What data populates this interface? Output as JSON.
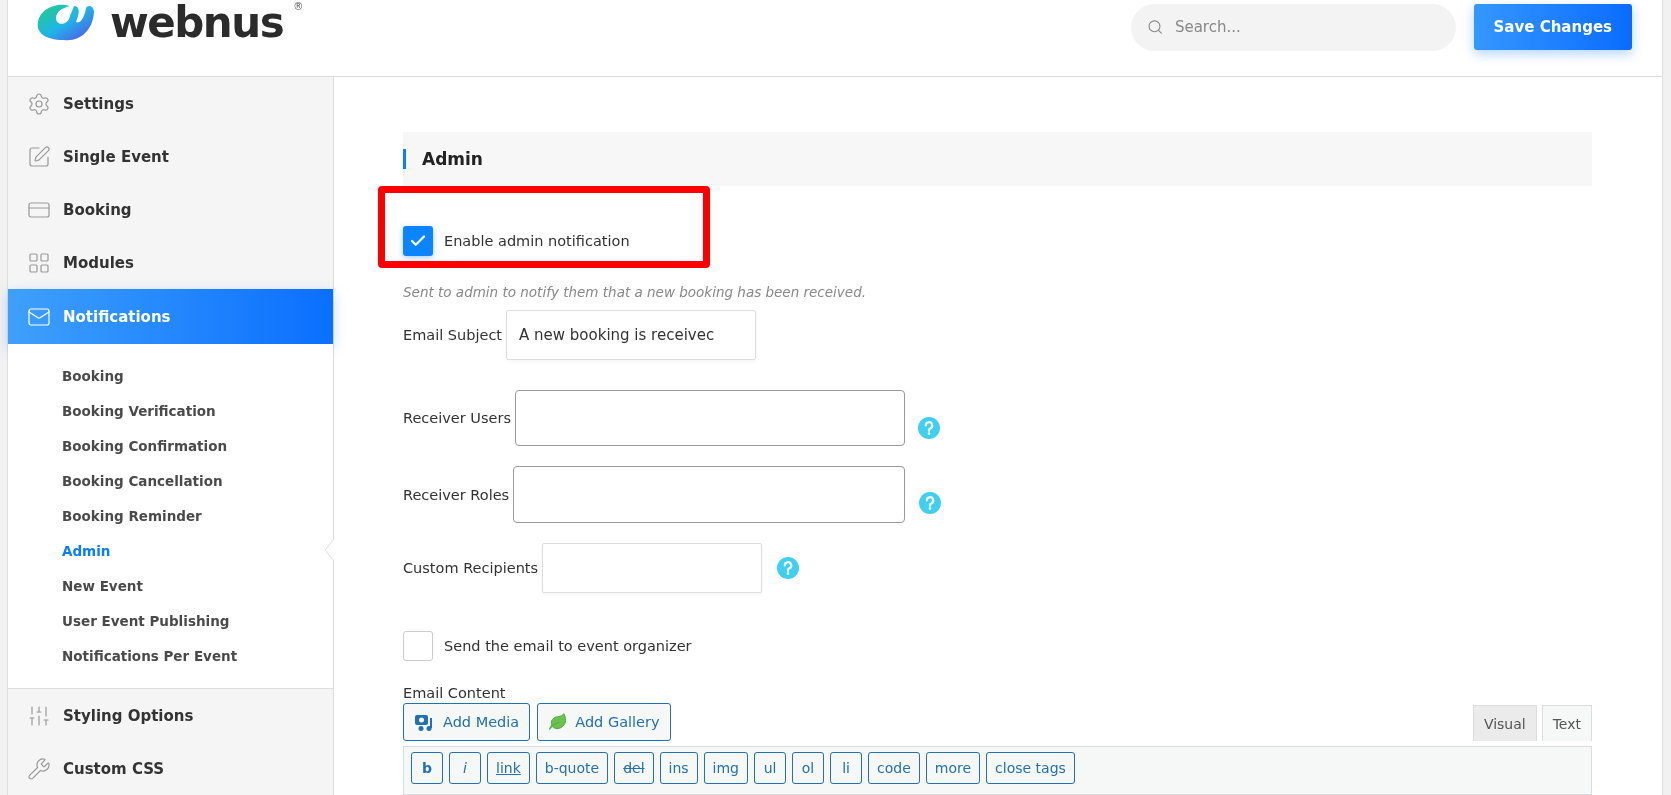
{
  "logo": {
    "text": "webnus",
    "mark": "®"
  },
  "search": {
    "placeholder": "Search..."
  },
  "save_button": "Save Changes",
  "sidebar": {
    "items": [
      {
        "label": "Settings",
        "selected": false
      },
      {
        "label": "Single Event",
        "selected": false
      },
      {
        "label": "Booking",
        "selected": false
      },
      {
        "label": "Modules",
        "selected": false
      },
      {
        "label": "Notifications",
        "selected": true,
        "expanded": true,
        "children": [
          {
            "label": "Booking",
            "selected": false
          },
          {
            "label": "Booking Verification",
            "selected": false
          },
          {
            "label": "Booking Confirmation",
            "selected": false
          },
          {
            "label": "Booking Cancellation",
            "selected": false
          },
          {
            "label": "Booking Reminder",
            "selected": false
          },
          {
            "label": "Admin",
            "selected": true
          },
          {
            "label": "New Event",
            "selected": false
          },
          {
            "label": "User Event Publishing",
            "selected": false
          },
          {
            "label": "Notifications Per Event",
            "selected": false
          }
        ]
      },
      {
        "label": "Styling Options",
        "selected": false
      },
      {
        "label": "Custom CSS",
        "selected": false
      }
    ]
  },
  "section": {
    "title": "Admin",
    "enable": {
      "label": "Enable admin notification",
      "checked": true,
      "highlighted": true
    },
    "description": "Sent to admin to notify them that a new booking has been received.",
    "email_subject": {
      "label": "Email Subject",
      "value": "A new booking is receivec"
    },
    "receiver_users": {
      "label": "Receiver Users"
    },
    "receiver_roles": {
      "label": "Receiver Roles"
    },
    "custom_recipients": {
      "label": "Custom Recipients"
    },
    "send_to_organizer": {
      "label": "Send the email to event organizer",
      "checked": false
    },
    "email_content": {
      "label": "Email Content",
      "media_buttons": [
        "Add Media",
        "Add Gallery"
      ],
      "tabs": [
        {
          "label": "Visual",
          "selected": false
        },
        {
          "label": "Text",
          "selected": true
        }
      ],
      "toolbar": [
        {
          "label": "b",
          "kind": "bold"
        },
        {
          "label": "i",
          "kind": "italic"
        },
        {
          "label": "link",
          "kind": "link"
        },
        {
          "label": "b-quote",
          "kind": "plain"
        },
        {
          "label": "del",
          "kind": "strike"
        },
        {
          "label": "ins",
          "kind": "plain"
        },
        {
          "label": "img",
          "kind": "plain"
        },
        {
          "label": "ul",
          "kind": "plain"
        },
        {
          "label": "ol",
          "kind": "plain"
        },
        {
          "label": "li",
          "kind": "plain"
        },
        {
          "label": "code",
          "kind": "plain"
        },
        {
          "label": "more",
          "kind": "plain"
        },
        {
          "label": "close tags",
          "kind": "plain"
        }
      ]
    }
  }
}
